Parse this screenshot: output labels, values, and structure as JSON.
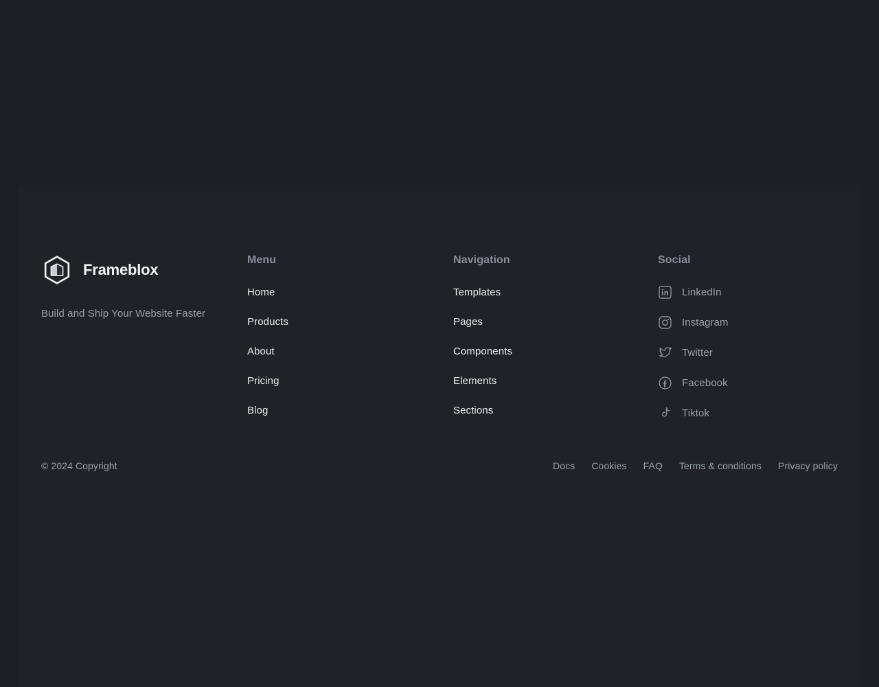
{
  "colors": {
    "page_background": "#1d1f24",
    "panel_background": "#202227",
    "heading_text": "#878d99",
    "link_text": "#e8eaee",
    "muted_text": "#9aa0ab",
    "brand_text": "#f2f3f5"
  },
  "brand": {
    "logo_icon": "hexagon-cube-logo-icon",
    "name": "Frameblox",
    "tagline": "Build and Ship Your Website Faster"
  },
  "columns": {
    "menu": {
      "title": "Menu",
      "links": [
        {
          "label": "Home"
        },
        {
          "label": "Products"
        },
        {
          "label": "About"
        },
        {
          "label": "Pricing"
        },
        {
          "label": "Blog"
        }
      ]
    },
    "navigation": {
      "title": "Navigation",
      "links": [
        {
          "label": "Templates"
        },
        {
          "label": "Pages"
        },
        {
          "label": "Components"
        },
        {
          "label": "Elements"
        },
        {
          "label": "Sections"
        }
      ]
    },
    "social": {
      "title": "Social",
      "links": [
        {
          "label": "LinkedIn",
          "icon": "linkedin-icon"
        },
        {
          "label": "Instagram",
          "icon": "instagram-icon"
        },
        {
          "label": "Twitter",
          "icon": "twitter-icon"
        },
        {
          "label": "Facebook",
          "icon": "facebook-icon"
        },
        {
          "label": "Tiktok",
          "icon": "tiktok-icon"
        }
      ]
    }
  },
  "bottom_bar": {
    "copyright": "© 2024 Copyright",
    "legal_links": [
      {
        "label": "Docs"
      },
      {
        "label": "Cookies"
      },
      {
        "label": "FAQ"
      },
      {
        "label": "Terms & conditions"
      },
      {
        "label": "Privacy policy"
      }
    ]
  }
}
